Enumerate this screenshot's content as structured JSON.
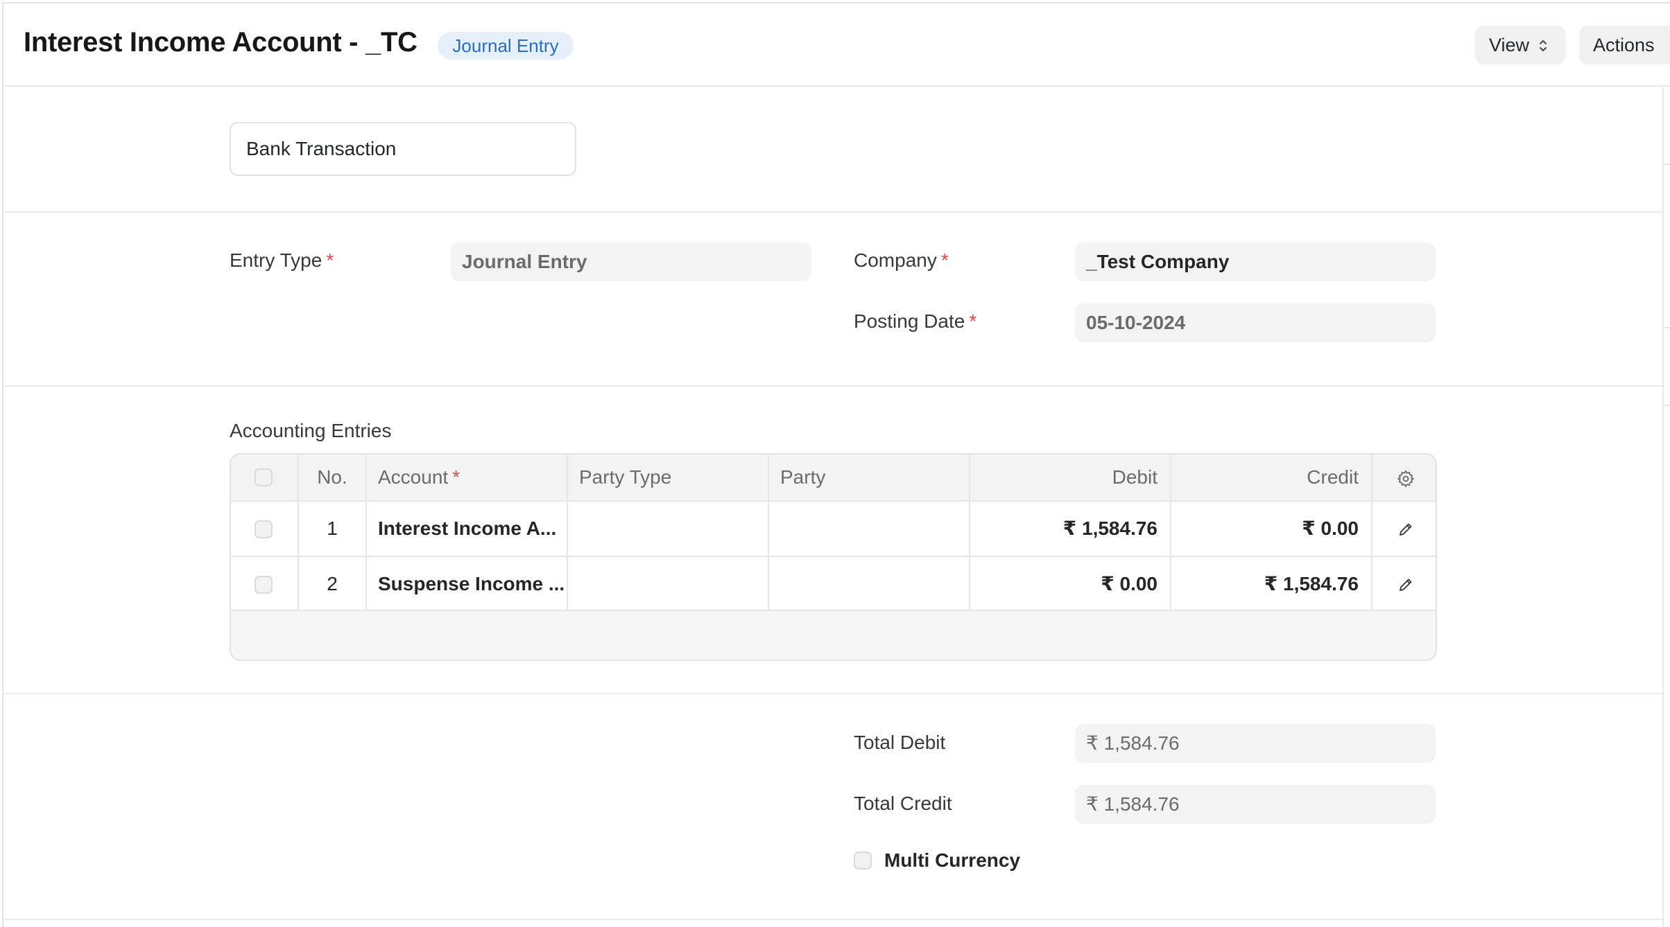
{
  "header": {
    "title": "Interest Income Account - _TC",
    "doctype_badge": "Journal Entry",
    "view_button": "View",
    "actions_button": "Actions",
    "updown_icon": "chevron-up-down-icon"
  },
  "form": {
    "title_field_value": "Bank Transaction",
    "entry_type": {
      "label": "Entry Type",
      "required": "*",
      "value": "Journal Entry"
    },
    "company": {
      "label": "Company",
      "required": "*",
      "value": "_Test Company"
    },
    "posting_date": {
      "label": "Posting Date",
      "required": "*",
      "value": "05-10-2024"
    }
  },
  "accounting_entries": {
    "section_label": "Accounting Entries",
    "columns": {
      "no": "No.",
      "account": "Account",
      "account_required": "*",
      "party_type": "Party Type",
      "party": "Party",
      "debit": "Debit",
      "credit": "Credit"
    },
    "settings_icon": "gear-icon",
    "edit_icon": "pencil-icon",
    "rows": [
      {
        "no": "1",
        "account": "Interest Income A...",
        "party_type": "",
        "party": "",
        "debit": "₹ 1,584.76",
        "credit": "₹ 0.00"
      },
      {
        "no": "2",
        "account": "Suspense Income ...",
        "party_type": "",
        "party": "",
        "debit": "₹ 0.00",
        "credit": "₹ 1,584.76"
      }
    ]
  },
  "totals": {
    "total_debit": {
      "label": "Total Debit",
      "value": "₹ 1,584.76"
    },
    "total_credit": {
      "label": "Total Credit",
      "value": "₹ 1,584.76"
    },
    "multi_currency": {
      "label": "Multi Currency",
      "checked": false
    }
  },
  "colors": {
    "badge_bg": "#e6f0fb",
    "badge_text": "#2b6cc4",
    "required_star": "#e24c4c",
    "field_bg": "#f3f3f3",
    "border": "#e2e2e2"
  }
}
